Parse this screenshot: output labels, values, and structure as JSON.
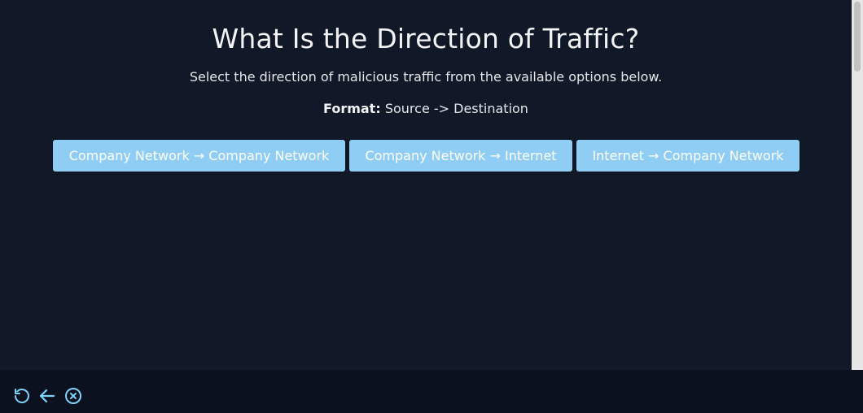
{
  "main": {
    "title": "What Is the Direction of Traffic?",
    "subtitle": "Select the direction of malicious traffic from the available options below.",
    "format_label": "Format:",
    "format_value": "Source -> Destination",
    "options": [
      {
        "label": "Company Network → Company Network"
      },
      {
        "label": "Company Network → Internet"
      },
      {
        "label": "Internet → Company Network"
      }
    ]
  },
  "footer": {
    "controls": [
      {
        "icon": "restart-icon"
      },
      {
        "icon": "back-arrow-icon"
      },
      {
        "icon": "close-circle-icon"
      }
    ]
  },
  "colors": {
    "background": "#111827",
    "footer": "#0b111e",
    "option_button": "#90cdf4",
    "icon_accent": "#7dd3fc",
    "text": "#f3f4f6"
  }
}
